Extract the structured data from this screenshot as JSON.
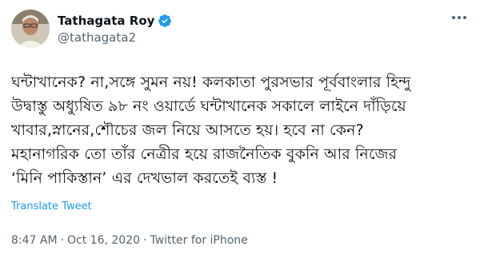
{
  "author": {
    "name": "Tathagata Roy",
    "handle": "@tathagata2",
    "verified": true
  },
  "tweet": {
    "lines": [
      "ঘন্টাখানেক? না,সঙ্গে সুমন নয়! কলকাতা পুরসভার পূর্ববাংলার হিন্দু",
      "উদ্বাস্তু অধ্যুষিত ৯৮ নং ওয়ার্ডে ঘন্টাখানেক সকালে লাইনে দাঁড়িয়ে",
      "খাবার,স্নানের,শৌচের জল নিয়ে আসতে হয়।  হবে না কেন?",
      "মহানাগরিক তো তাঁর নেত্রীর হয়ে রাজনৈতিক বুকনি আর নিজের",
      "‘মিনি পাকিস্তান’ এর দেখভাল করতেই ব্যস্ত !"
    ],
    "translate_label": "Translate Tweet",
    "time": "8:47 AM",
    "separator": "·",
    "date": "Oct 16, 2020",
    "source": "Twitter for iPhone"
  },
  "colors": {
    "link": "#1d9bf0",
    "verified": "#1d9bf0",
    "secondary_text": "#536471"
  },
  "icons": {
    "verified": "verified-badge-icon",
    "more": "more-options-icon"
  }
}
